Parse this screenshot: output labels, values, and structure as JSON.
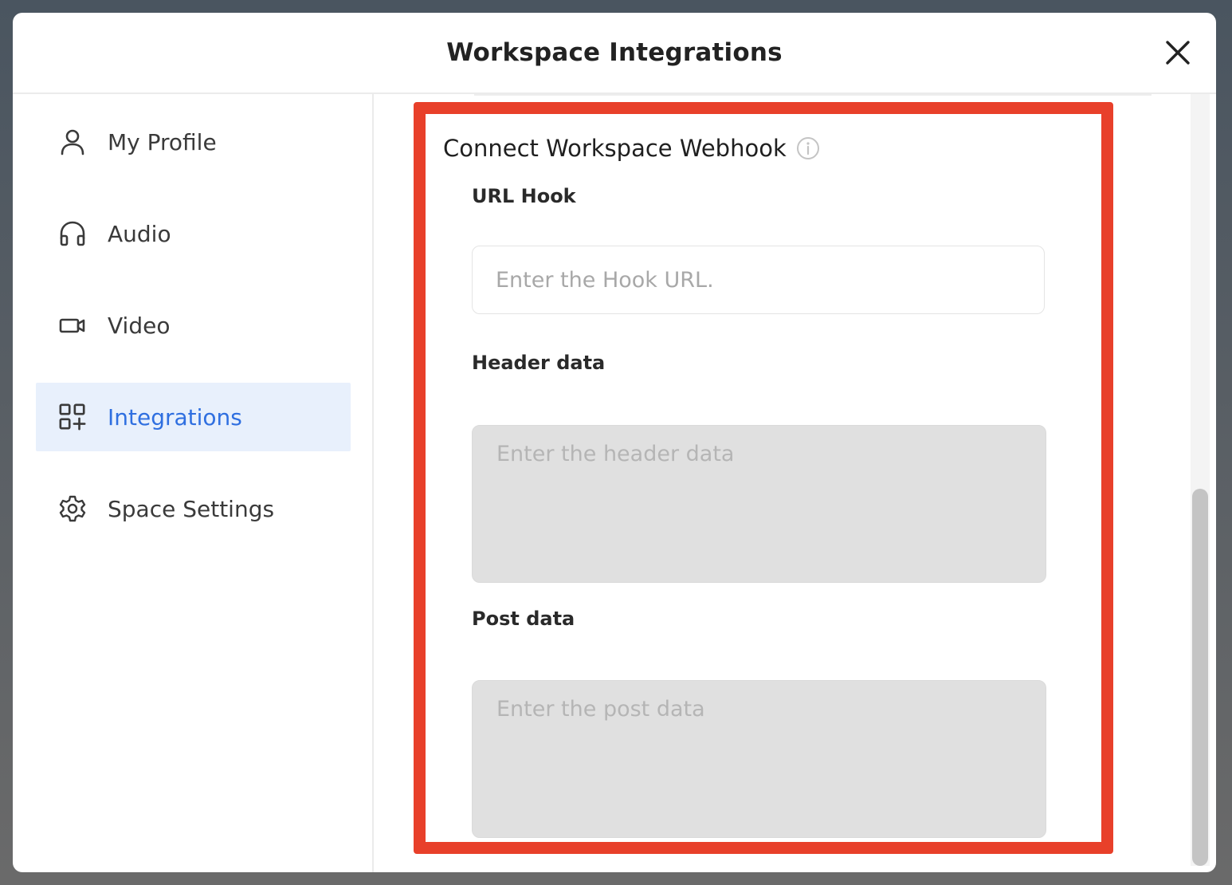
{
  "dialog": {
    "title": "Workspace Integrations"
  },
  "sidebar": {
    "items": [
      {
        "label": "My Profile",
        "icon": "user-icon",
        "active": false
      },
      {
        "label": "Audio",
        "icon": "headphones-icon",
        "active": false
      },
      {
        "label": "Video",
        "icon": "video-camera-icon",
        "active": false
      },
      {
        "label": "Integrations",
        "icon": "integrations-grid-icon",
        "active": true
      },
      {
        "label": "Space Settings",
        "icon": "gear-icon",
        "active": false
      }
    ]
  },
  "webhook": {
    "section_title": "Connect Workspace Webhook",
    "url_hook": {
      "label": "URL Hook",
      "placeholder": "Enter the Hook URL.",
      "value": ""
    },
    "header_data": {
      "label": "Header data",
      "placeholder": "Enter the header data",
      "value": ""
    },
    "post_data": {
      "label": "Post data",
      "placeholder": "Enter the post data",
      "value": ""
    }
  },
  "colors": {
    "accent": "#2f6fe0",
    "active_bg": "#e8f0fc",
    "highlight": "#e8402a"
  }
}
